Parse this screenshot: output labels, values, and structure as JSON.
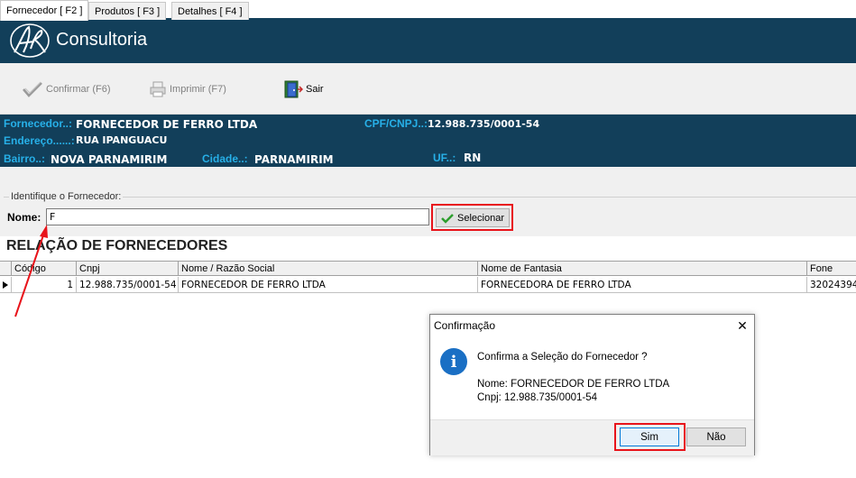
{
  "header": {
    "brand": "Consultoria"
  },
  "toolbar": {
    "confirm_label": "Confirmar (F6)",
    "print_label": "Imprimir  (F7)",
    "exit_label": "Sair"
  },
  "supplier": {
    "fornecedor_label": "Fornecedor..:",
    "fornecedor_value": "FORNECEDOR DE FERRO LTDA",
    "cpf_label": "CPF/CNPJ..:",
    "cpf_value": "12.988.735/0001-54",
    "endereco_label": "Endereço......:",
    "endereco_value": "RUA IPANGUACU",
    "bairro_label": "Bairro..:",
    "bairro_value": "NOVA PARNAMIRIM",
    "cidade_label": "Cidade..:",
    "cidade_value": "PARNAMIRIM",
    "uf_label": "UF..:",
    "uf_value": "RN"
  },
  "tabs": [
    {
      "label": "Fornecedor [ F2 ]"
    },
    {
      "label": "Produtos [ F3 ]"
    },
    {
      "label": "Detalhes [ F4 ]"
    }
  ],
  "filter": {
    "group_title": "Identifique o Fornecedor:",
    "nome_label": "Nome:",
    "nome_value": "F",
    "select_label": "Selecionar"
  },
  "list": {
    "title": "RELAÇÃO DE FORNECEDORES",
    "columns": [
      "Código",
      "Cnpj",
      "Nome / Razão Social",
      "Nome de Fantasia",
      "Fone"
    ],
    "rows": [
      [
        "1",
        "12.988.735/0001-54",
        "FORNECEDOR DE FERRO LTDA",
        "FORNECEDORA DE FERRO LTDA",
        "32024394"
      ]
    ]
  },
  "dialog": {
    "title": "Confirmação",
    "close_glyph": "✕",
    "icon_glyph": "i",
    "message": "Confirma a Seleção do Fornecedor ?",
    "nome_line": "Nome: FORNECEDOR DE FERRO LTDA",
    "cnpj_line": "Cnpj: 12.988.735/0001-54",
    "yes_label": "Sim",
    "no_label": "Não"
  },
  "colors": {
    "banner": "#123f5a",
    "label_blue": "#27b0e8",
    "highlight_red": "#e8141b"
  }
}
